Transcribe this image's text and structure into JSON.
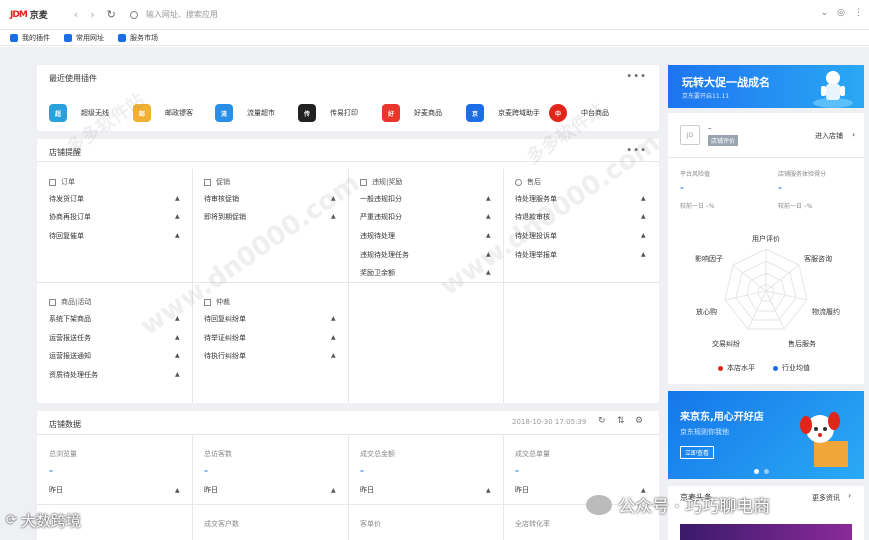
{
  "browser": {
    "logo_jdm": "JDM",
    "logo_name": "京麦",
    "search_placeholder": "输入网址、搜索应用"
  },
  "bookmarks": [
    "我的插件",
    "常用网址",
    "服务市场"
  ],
  "recent_plugins": {
    "title": "最近使用插件",
    "items": [
      {
        "label": "超级无线",
        "color": "#2aa0dc",
        "glyph": "超"
      },
      {
        "label": "邮政镖客",
        "color": "#f1b030",
        "glyph": "邮"
      },
      {
        "label": "流量超市",
        "color": "#2b8ee6",
        "glyph": "流"
      },
      {
        "label": "传易打印",
        "color": "#222222",
        "glyph": "传"
      },
      {
        "label": "好麦商品",
        "color": "#e8362a",
        "glyph": "好"
      },
      {
        "label": "京麦跨域助手",
        "color": "#1b6ee6",
        "glyph": "京"
      },
      {
        "label": "中台商品",
        "color": "#e2251b",
        "glyph": "中"
      }
    ]
  },
  "shop_alerts": {
    "title": "店铺提醒",
    "columns": [
      {
        "header": "订单",
        "rows": [
          "待发货订单",
          "协商再投订单",
          "待回复催单"
        ]
      },
      {
        "header": "促销",
        "rows": [
          "待审核促销",
          "即将到期促销"
        ]
      },
      {
        "header": "违规|奖励",
        "rows": [
          "一般违规扣分",
          "严重违规扣分",
          "违规待处理",
          "违规待处理任务",
          "奖励卫余额"
        ]
      },
      {
        "header": "售后",
        "rows": [
          "待处理服务单",
          "待退款审核",
          "待处理投诉单",
          "待处理举报单"
        ]
      },
      {
        "header": "商品|活动",
        "rows": [
          "系统下架商品",
          "运营报送任务",
          "运营报送通知",
          "资质待处理任务"
        ]
      },
      {
        "header": "仲裁",
        "rows": [
          "待回复纠纷单",
          "待举证纠纷单",
          "待执行纠纷单"
        ]
      }
    ]
  },
  "shop_data": {
    "title": "店铺数据",
    "timestamp": "2018-10-30 17:05:39",
    "metrics": [
      {
        "label": "总浏览量",
        "value": "–",
        "yesterday": "昨日"
      },
      {
        "label": "总访客数",
        "value": "–",
        "yesterday": "昨日"
      },
      {
        "label": "成交总金额",
        "value": "–",
        "yesterday": "昨日"
      },
      {
        "label": "成交总单量",
        "value": "–",
        "yesterday": "昨日"
      }
    ],
    "metrics_row2": [
      "成交客户数",
      "客单价",
      "全店转化率"
    ]
  },
  "banner1": {
    "title": "玩转大促一战成名",
    "subtitle": "京东要开启11.11"
  },
  "store_panel": {
    "store_name": "–",
    "store_status": "店铺评价",
    "enter_store": "进入店铺",
    "risk_label": "平台风险值",
    "risk_value": "–",
    "risk_compare": "较前一日 –%",
    "score_label": "店铺服务体验得分",
    "score_value": "–",
    "score_compare": "较前一日 –%"
  },
  "radar": {
    "labels": [
      "用户评价",
      "客服咨询",
      "物流履约",
      "售后服务",
      "交易纠纷",
      "放心购",
      "影响因子"
    ],
    "legend": [
      {
        "label": "本店水平",
        "color": "#e2251b"
      },
      {
        "label": "行业均值",
        "color": "#1b6ee6"
      }
    ]
  },
  "banner2": {
    "title": "来京东,用心开好店",
    "subtitle": "京东规则你我他",
    "button": "立即查看"
  },
  "headline": {
    "title": "京麦头条",
    "more": "更多资讯"
  },
  "watermarks": {
    "left": "大数跨境",
    "right": "公众号 · 巧巧聊电商",
    "diagonal": [
      "www.dn0000.com",
      "多多软件站"
    ]
  },
  "icon_names": {
    "back": "back-arrow-icon",
    "forward": "forward-arrow-icon",
    "refresh": "refresh-icon",
    "search": "search-icon",
    "chevron": "chevron-down-icon",
    "profile": "profile-icon",
    "settings": "settings-icon"
  }
}
